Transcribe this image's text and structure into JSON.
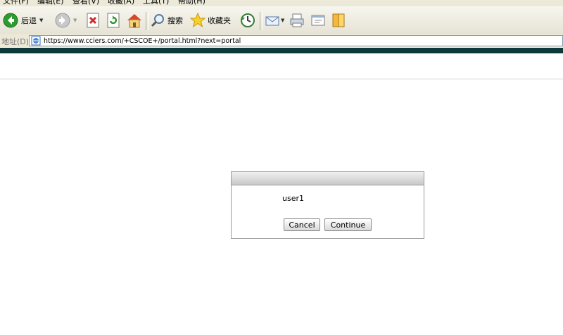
{
  "menubar": {
    "items": [
      {
        "label": "文件(F)"
      },
      {
        "label": "编辑(E)"
      },
      {
        "label": "查看(V)"
      },
      {
        "label": "收藏(A)"
      },
      {
        "label": "工具(T)"
      },
      {
        "label": "帮助(H)"
      }
    ]
  },
  "toolbar": {
    "back_label": "后退",
    "search_label": "搜索",
    "favorites_label": "收藏夹"
  },
  "address": {
    "label": "地址(D)",
    "url": "https://www.cciers.com/+CSCOE+/portal.html?next=portal"
  },
  "dialog": {
    "username": "user1",
    "cancel_label": "Cancel",
    "continue_label": "Continue"
  },
  "colors": {
    "band": "#0c3a3a",
    "address_border": "#7f9db9"
  }
}
